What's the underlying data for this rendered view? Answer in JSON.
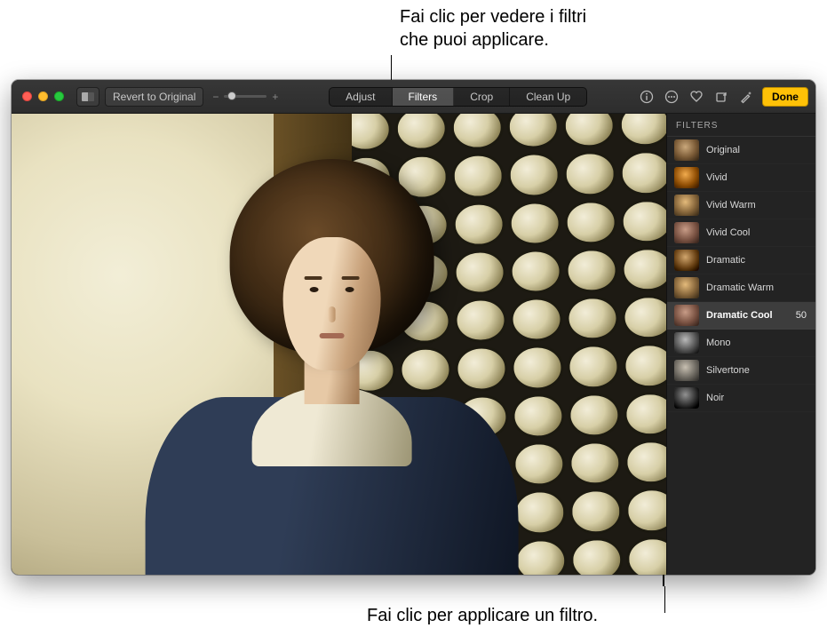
{
  "annotations": {
    "top": "Fai clic per vedere i filtri\nche puoi applicare.",
    "bottom": "Fai clic per applicare un filtro."
  },
  "toolbar": {
    "revert_label": "Revert to Original",
    "tabs": {
      "adjust": "Adjust",
      "filters": "Filters",
      "crop": "Crop",
      "cleanup": "Clean Up"
    },
    "done_label": "Done"
  },
  "sidebar": {
    "title": "FILTERS",
    "items": [
      {
        "label": "Original",
        "thumb": "orig",
        "selected": false
      },
      {
        "label": "Vivid",
        "thumb": "vivid",
        "selected": false
      },
      {
        "label": "Vivid Warm",
        "thumb": "warm",
        "selected": false
      },
      {
        "label": "Vivid Cool",
        "thumb": "cool",
        "selected": false
      },
      {
        "label": "Dramatic",
        "thumb": "dram",
        "selected": false
      },
      {
        "label": "Dramatic Warm",
        "thumb": "warm",
        "selected": false
      },
      {
        "label": "Dramatic Cool",
        "thumb": "cool",
        "selected": true,
        "value": "50"
      },
      {
        "label": "Mono",
        "thumb": "mono",
        "selected": false
      },
      {
        "label": "Silvertone",
        "thumb": "silver",
        "selected": false
      },
      {
        "label": "Noir",
        "thumb": "noir",
        "selected": false
      }
    ]
  }
}
